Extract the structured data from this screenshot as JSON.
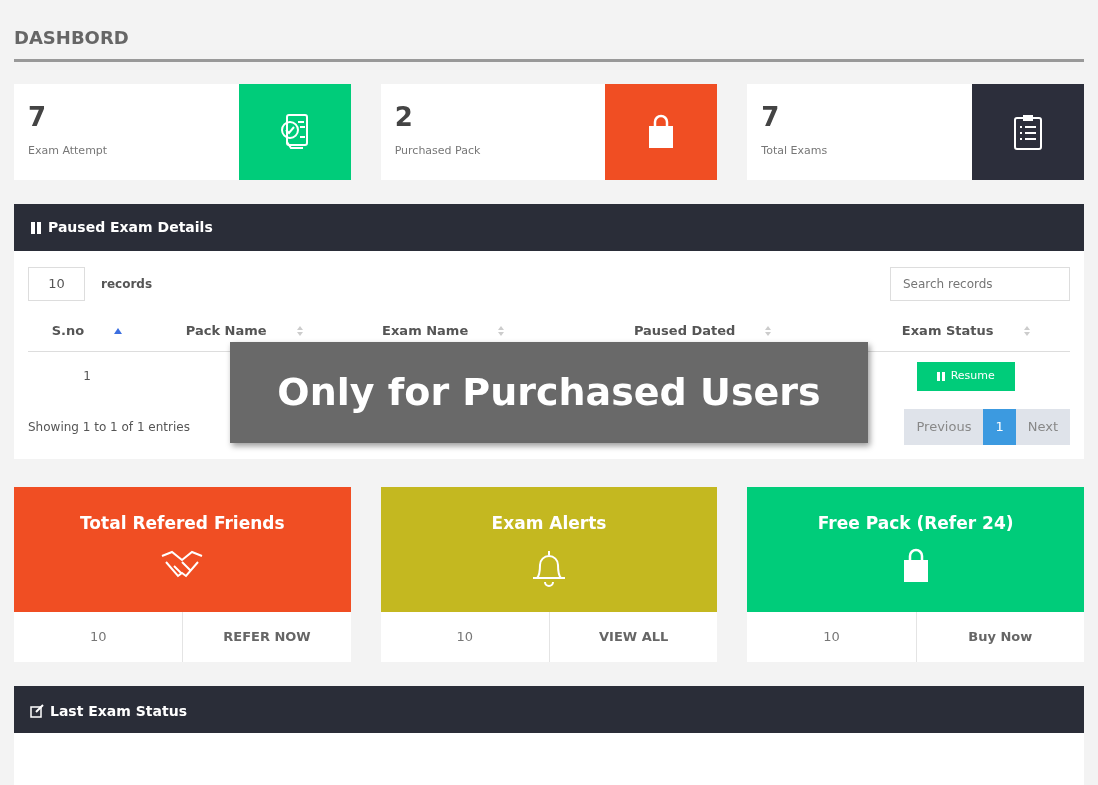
{
  "page_title": "DASHBORD",
  "stats": [
    {
      "value": "7",
      "label": "Exam Attempt",
      "color": "#00cc7a",
      "kind": "exam"
    },
    {
      "value": "2",
      "label": "Purchased Pack",
      "color": "#f04e23",
      "kind": "bag"
    },
    {
      "value": "7",
      "label": "Total Exams",
      "color": "#2c2e3b",
      "kind": "clipboard"
    }
  ],
  "paused_panel": {
    "title": "Paused Exam Details",
    "page_size": "10",
    "page_size_label": "records",
    "search": {
      "placeholder": "Search records"
    },
    "columns": [
      {
        "label": "S.no",
        "sorted": true
      },
      {
        "label": "Pack Name",
        "sorted": false
      },
      {
        "label": "Exam Name",
        "sorted": false
      },
      {
        "label": "Paused Dated",
        "sorted": false
      },
      {
        "label": "Exam Status",
        "sorted": false
      }
    ],
    "rows": [
      {
        "s_no": "1",
        "status_button": "Resume"
      }
    ],
    "info": "Showing 1 to 1 of 1 entries",
    "pagination": [
      {
        "label": "Previous",
        "selected": false
      },
      {
        "label": "1",
        "selected": true
      },
      {
        "label": "Next",
        "selected": false
      }
    ]
  },
  "tiles": [
    {
      "title": "Total Refered Friends",
      "color": "#f04e23",
      "kind": "handshake",
      "count": "10",
      "action": "REFER NOW"
    },
    {
      "title": "Exam Alerts",
      "color": "#c4b820",
      "kind": "bell",
      "count": "10",
      "action": "VIEW ALL"
    },
    {
      "title": "Free Pack (Refer 24)",
      "color": "#00cc7a",
      "kind": "bag",
      "count": "10",
      "action": "Buy Now"
    }
  ],
  "last_panel": {
    "title": "Last Exam Status"
  },
  "overlay": {
    "text": "Only for Purchased Users"
  }
}
